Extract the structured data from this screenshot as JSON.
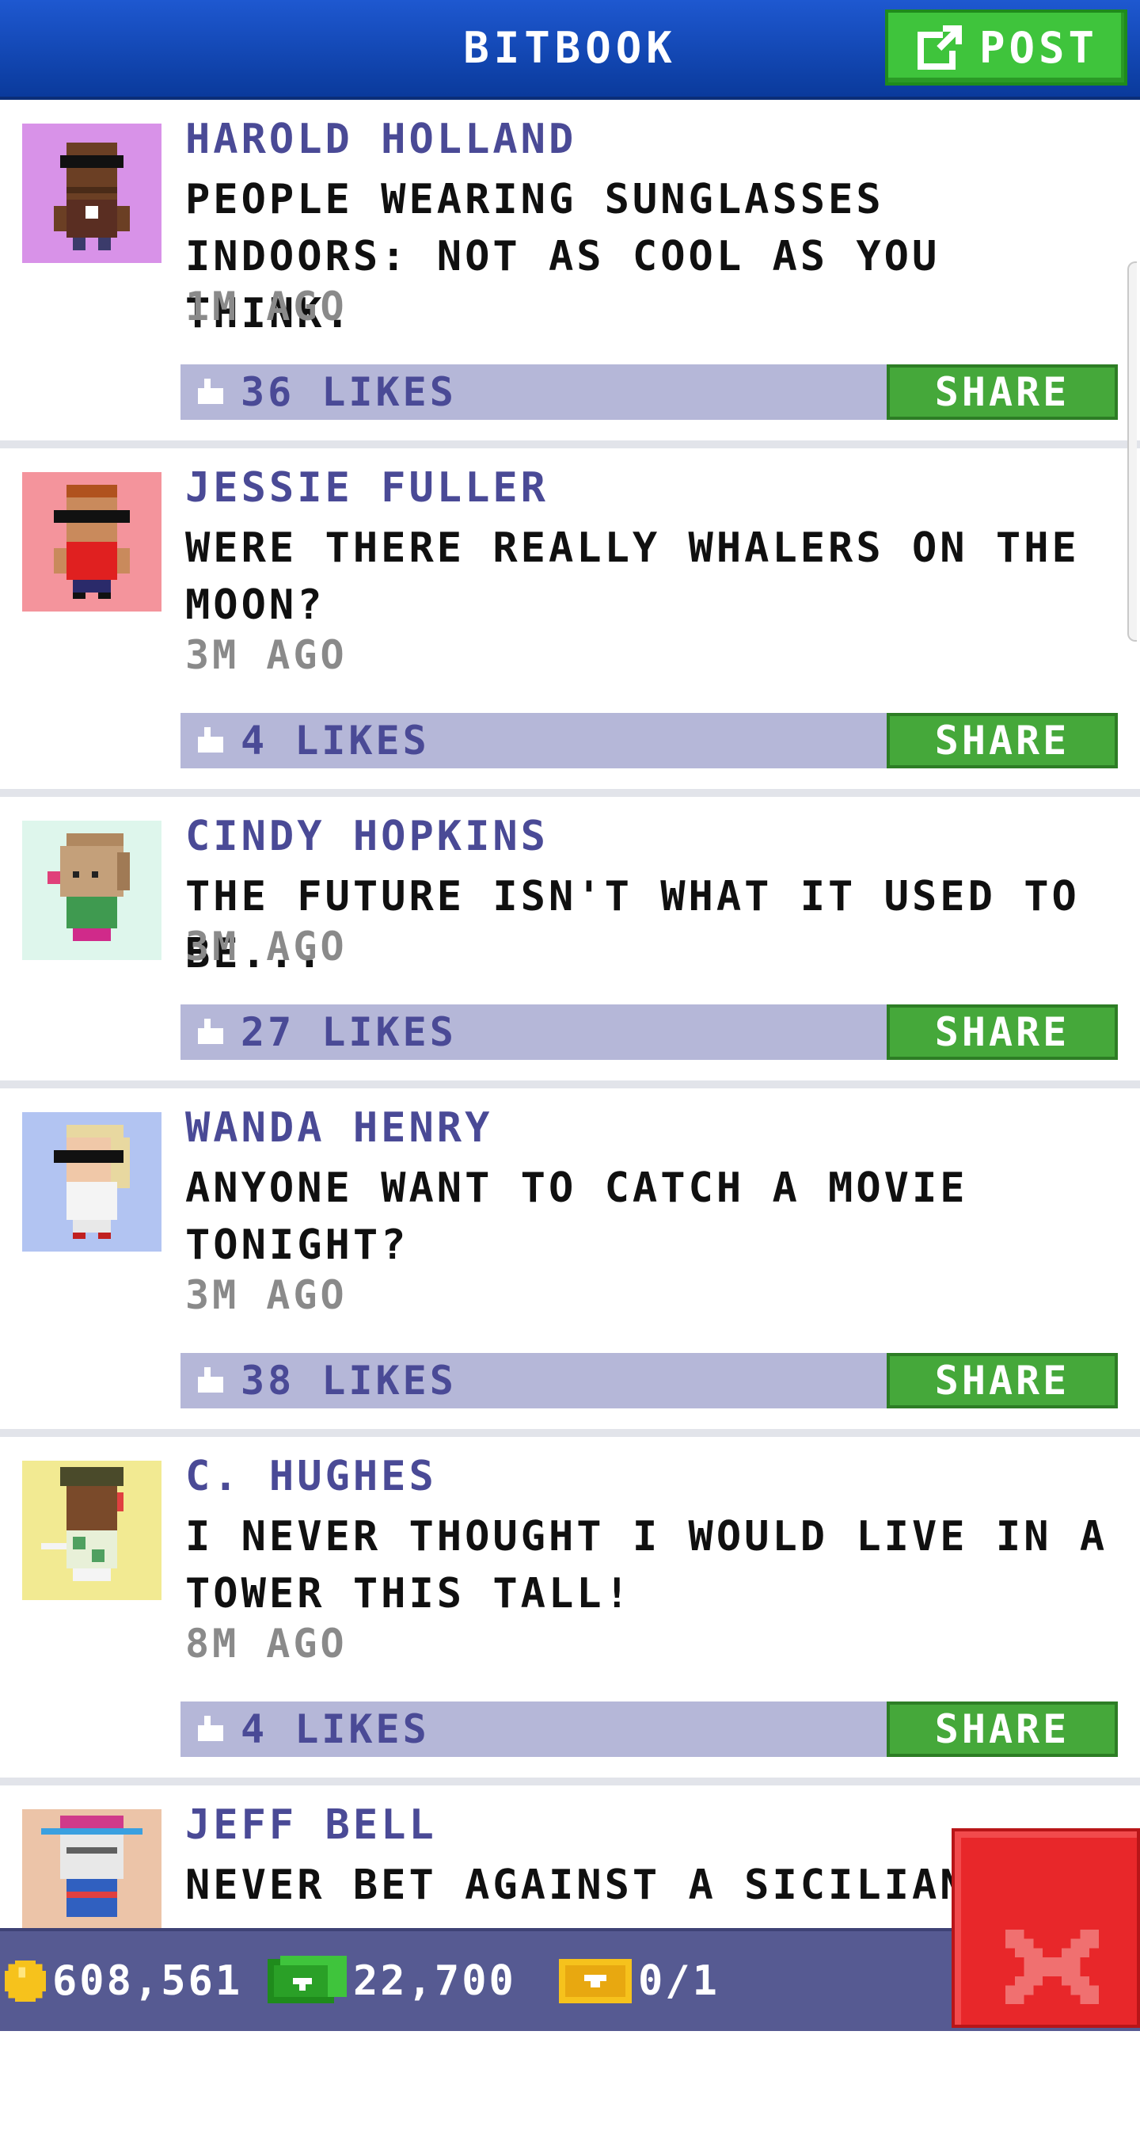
{
  "header": {
    "title": "BITBOOK",
    "post_label": "POST",
    "post_icon": "compose-icon"
  },
  "colors": {
    "header_blue": "#1e58d0",
    "post_green": "#3fc43c",
    "share_green": "#45a83a",
    "like_bar": "#b5b7d8",
    "author_purple": "#4a4a96",
    "close_red": "#e8272a",
    "status_bar": "#565a92"
  },
  "posts": [
    {
      "author": "HAROLD HOLLAND",
      "message_lines": [
        "PEOPLE WEARING SUNGLASSES",
        "INDOORS: NOT AS COOL AS YOU THINK."
      ],
      "time": "1M AGO",
      "likes": "36 LIKES",
      "share": "SHARE",
      "avatar_bg": "#d892e8"
    },
    {
      "author": "JESSIE FULLER",
      "message_lines": [
        "WERE THERE REALLY WHALERS ON THE",
        "MOON?"
      ],
      "time": "3M AGO",
      "likes": "4 LIKES",
      "share": "SHARE",
      "avatar_bg": "#f4949c"
    },
    {
      "author": "CINDY HOPKINS",
      "message_lines": [
        "THE FUTURE ISN'T WHAT IT USED TO BE..."
      ],
      "time": "3M AGO",
      "likes": "27 LIKES",
      "share": "SHARE",
      "avatar_bg": "#def6ec"
    },
    {
      "author": "WANDA HENRY",
      "message_lines": [
        "ANYONE WANT TO CATCH A MOVIE",
        "TONIGHT?"
      ],
      "time": "3M AGO",
      "likes": "38 LIKES",
      "share": "SHARE",
      "avatar_bg": "#b2c4f2"
    },
    {
      "author": "C. HUGHES",
      "message_lines": [
        "I NEVER THOUGHT I WOULD LIVE IN A",
        "TOWER THIS TALL!"
      ],
      "time": "8M AGO",
      "likes": "4 LIKES",
      "share": "SHARE",
      "avatar_bg": "#f2ea92"
    },
    {
      "author": "JEFF BELL",
      "message_lines": [
        "NEVER BET AGAINST A SICILIAN"
      ],
      "avatar_bg": "#ecc4a8"
    }
  ],
  "status": {
    "coins": "608,561",
    "bux": "22,700",
    "tickets": "0/1"
  }
}
